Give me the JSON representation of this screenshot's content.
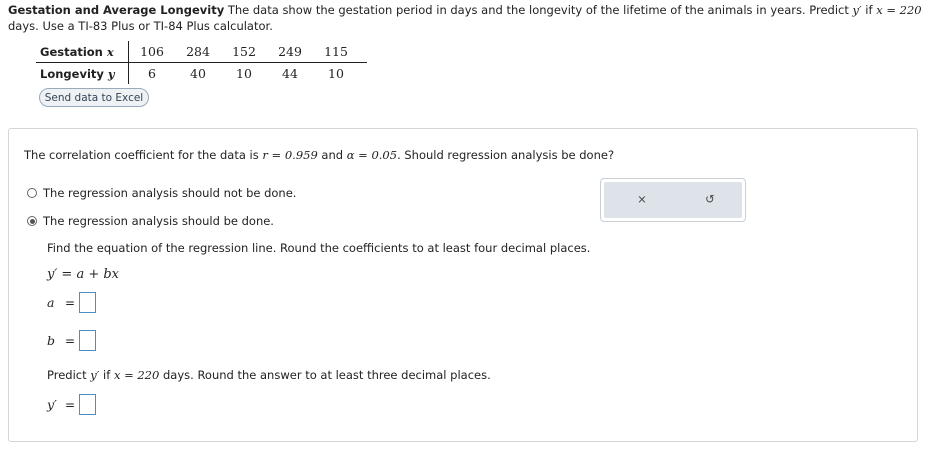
{
  "problem": {
    "title": "Gestation and Average Longevity",
    "text_before_y": " The data show the gestation period in days and the longevity of the lifetime of the animals in years. Predict ",
    "y_prime": "y′",
    "text_if": " if ",
    "x_eq": "x = 220",
    "text_after": " days. Use a TI-83 Plus or TI-84 Plus calculator."
  },
  "table": {
    "row1_label_text": "Gestation ",
    "row1_label_var": "x",
    "row1_values": [
      "106",
      "284",
      "152",
      "249",
      "115"
    ],
    "row2_label_text": "Longevity ",
    "row2_label_var": "y",
    "row2_values": [
      "6",
      "40",
      "10",
      "44",
      "10"
    ]
  },
  "excel_button_label": "Send data to Excel",
  "question": {
    "text_a": "The correlation coefficient for the data is ",
    "r_expr": "r = 0.959",
    "text_b": " and ",
    "alpha_expr": "α = 0.05",
    "text_c": ". Should regression analysis be done?"
  },
  "options": [
    {
      "label": "The regression analysis should not be done.",
      "selected": false
    },
    {
      "label": "The regression analysis should be done.",
      "selected": true
    }
  ],
  "part1_instruction": "Find the equation of the regression line. Round the coefficients to at least four decimal places.",
  "equation": "y′ = a + bx",
  "answers": {
    "a_label": "a",
    "b_label": "b",
    "eq_sign": "=",
    "a_value": "",
    "b_value": "",
    "y_value": ""
  },
  "predict": {
    "text_a": "Predict ",
    "y_prime": "y′",
    "text_b": " if ",
    "x_eq": "x = 220",
    "text_c": " days. Round the answer to at least three decimal places."
  },
  "predict_answer_label": "y′",
  "tools": {
    "clear_icon": "close-icon",
    "reset_icon": "undo-icon",
    "clear_glyph": "×",
    "reset_glyph": "↺"
  }
}
